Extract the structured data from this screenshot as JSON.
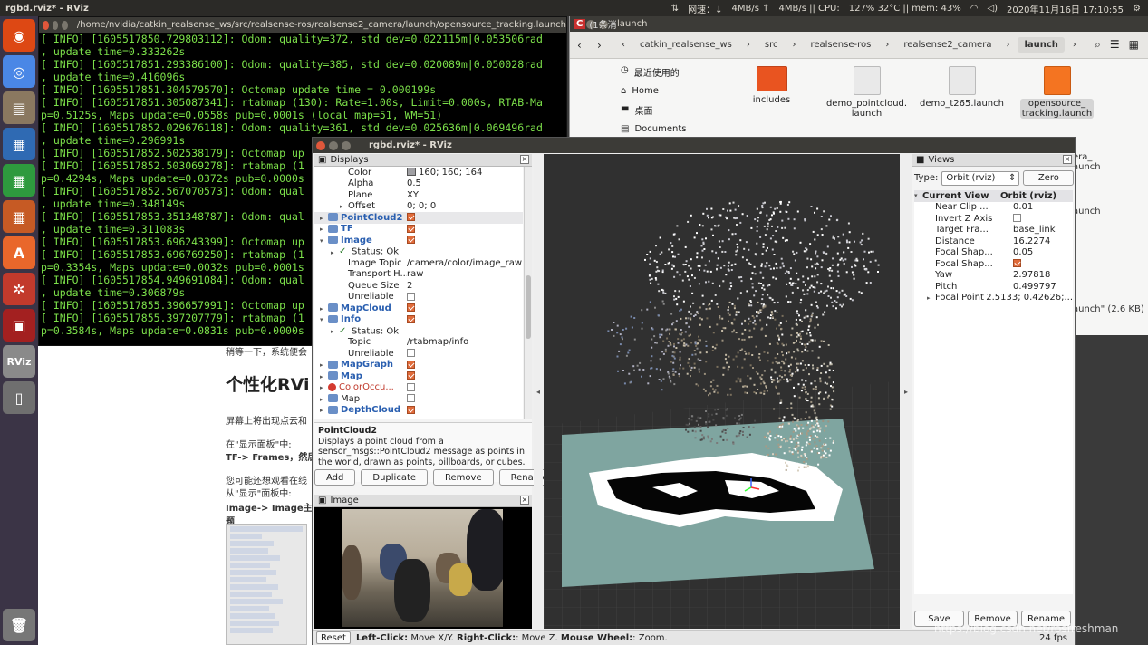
{
  "topbar": {
    "window_title": "rgbd.rviz* - RViz",
    "net_label": "网速：↓",
    "net_down": "4MB/s ↑",
    "net_up": "4MB/s || CPU:",
    "cpu": "127% 32°C || mem: 43%",
    "datetime": "2020年11月16日 17:10:55"
  },
  "launcher": {
    "items": [
      {
        "name": "ubuntu-dash-icon",
        "color": "#dd4814",
        "glyph": "◉"
      },
      {
        "name": "chrome-icon",
        "color": "#4a87e6",
        "glyph": "◎"
      },
      {
        "name": "files-icon",
        "color": "#8a7860",
        "glyph": "▤"
      },
      {
        "name": "writer-icon",
        "color": "#2f6ab3",
        "glyph": "▦"
      },
      {
        "name": "calc-icon",
        "color": "#2e9a3e",
        "glyph": "▦"
      },
      {
        "name": "impress-icon",
        "color": "#c65a24",
        "glyph": "▦"
      },
      {
        "name": "software-center-icon",
        "color": "#e9672b",
        "glyph": "A"
      },
      {
        "name": "settings-icon",
        "color": "#c23a2c",
        "glyph": "✲"
      },
      {
        "name": "terminal-icon",
        "color": "#a32020",
        "glyph": "▣"
      },
      {
        "name": "rviz-icon",
        "color": "#8a8a8a",
        "glyph": "RViz"
      },
      {
        "name": "usb-drive-icon",
        "color": "#6f6f6f",
        "glyph": "▯"
      }
    ],
    "trash": {
      "name": "trash-icon",
      "color": "#777",
      "glyph": "🗑"
    }
  },
  "terminal": {
    "title": "/home/nvidia/catkin_realsense_ws/src/realsense-ros/realsense2_camera/launch/opensource_tracking.launch",
    "lines": [
      "[ INFO] [1605517850.729803112]: Odom: quality=372, std dev=0.022115m|0.053506rad",
      ", update time=0.333262s",
      "[ INFO] [1605517851.293386100]: Odom: quality=385, std dev=0.020089m|0.050028rad",
      ", update time=0.416096s",
      "[ INFO] [1605517851.304579570]: Octomap update time = 0.000199s",
      "[ INFO] [1605517851.305087341]: rtabmap (130): Rate=1.00s, Limit=0.000s, RTAB-Ma",
      "p=0.5125s, Maps update=0.0558s pub=0.0001s (local map=51, WM=51)",
      "[ INFO] [1605517852.029676118]: Odom: quality=361, std dev=0.025636m|0.069496rad",
      ", update time=0.296991s",
      "[ INFO] [1605517852.502538179]: Octomap up",
      "[ INFO] [1605517852.503069278]: rtabmap (1",
      "p=0.4294s, Maps update=0.0372s pub=0.0000s",
      "[ INFO] [1605517852.567070573]: Odom: qual",
      ", update time=0.348149s",
      "[ INFO] [1605517853.351348787]: Odom: qual",
      ", update time=0.311083s",
      "[ INFO] [1605517853.696243399]: Octomap up",
      "[ INFO] [1605517853.696769250]: rtabmap (1",
      "p=0.3354s, Maps update=0.0032s pub=0.0001s",
      "[ INFO] [1605517854.949691084]: Odom: qual",
      ", update time=0.306879s",
      "[ INFO] [1605517855.396657991]: Octomap up",
      "[ INFO] [1605517855.397207779]: rtabmap (1",
      "p=0.3584s, Maps update=0.0831s pub=0.0000s"
    ]
  },
  "files": {
    "title": "launch",
    "tab_peek": "(1条消",
    "breadcrumbs": [
      "catkin_realsense_ws",
      "src",
      "realsense-ros",
      "realsense2_camera",
      "launch"
    ],
    "sidebar": [
      {
        "icon": "clock-icon",
        "glyph": "◷",
        "label": "最近使用的"
      },
      {
        "icon": "home-icon",
        "glyph": "⌂",
        "label": "Home"
      },
      {
        "icon": "desktop-icon",
        "glyph": "▬",
        "label": "桌面"
      },
      {
        "icon": "documents-icon",
        "glyph": "▤",
        "label": "Documents"
      }
    ],
    "items": [
      {
        "label": "includes",
        "kind": "folder"
      },
      {
        "label": "demo_pointcloud.\nlaunch",
        "kind": "file"
      },
      {
        "label": "demo_t265.launch",
        "kind": "file"
      },
      {
        "label": "opensource_\ntracking.launch",
        "kind": "orange"
      }
    ],
    "peek_1": "era_",
    "peek_2": "aunch",
    "peek_3": "aunch",
    "peek_status": "aunch\" (2.6 KB)"
  },
  "webpage": {
    "line1": "稍等一下，系统便会",
    "heading": "个性化RVi",
    "line2": "屏幕上将出现点云和",
    "line3": "在\"显示面板\"中:",
    "line4": "TF-> Frames，然后",
    "line5": "您可能还想观看在线",
    "line6": "从\"显示\"面板中:",
    "line7": "Image-> Image主题"
  },
  "rviz": {
    "title": "rgbd.rviz* - RViz",
    "displays": {
      "header": "Displays",
      "rows": [
        {
          "key": "Color",
          "value": "160; 160; 164",
          "indent": 2,
          "swatch": true
        },
        {
          "key": "Alpha",
          "value": "0.5",
          "indent": 2
        },
        {
          "key": "Plane",
          "value": "XY",
          "indent": 2
        },
        {
          "key": "Offset",
          "value": "0; 0; 0",
          "indent": 2,
          "arrow": "▸"
        },
        {
          "key": "PointCloud2",
          "value": "",
          "indent": 0,
          "arrow": "▸",
          "check": true,
          "blue": true,
          "icon": "pointcloud-icon",
          "selected": true
        },
        {
          "key": "TF",
          "value": "",
          "indent": 0,
          "arrow": "▸",
          "check": true,
          "blue": true,
          "icon": "tf-icon"
        },
        {
          "key": "Image",
          "value": "",
          "indent": 0,
          "arrow": "▾",
          "check": true,
          "blue": true,
          "icon": "image-icon"
        },
        {
          "key": "Status: Ok",
          "value": "",
          "indent": 1,
          "arrow": "▸",
          "status": true
        },
        {
          "key": "Image Topic",
          "value": "/camera/color/image_raw",
          "indent": 2
        },
        {
          "key": "Transport H...",
          "value": "raw",
          "indent": 2
        },
        {
          "key": "Queue Size",
          "value": "2",
          "indent": 2
        },
        {
          "key": "Unreliable",
          "value": "",
          "indent": 2,
          "check": false
        },
        {
          "key": "MapCloud",
          "value": "",
          "indent": 0,
          "arrow": "▸",
          "check": true,
          "blue": true,
          "icon": "mapcloud-icon"
        },
        {
          "key": "Info",
          "value": "",
          "indent": 0,
          "arrow": "▾",
          "check": true,
          "blue": true,
          "icon": "info-icon"
        },
        {
          "key": "Status: Ok",
          "value": "",
          "indent": 1,
          "arrow": "▸",
          "status": true
        },
        {
          "key": "Topic",
          "value": "/rtabmap/info",
          "indent": 2
        },
        {
          "key": "Unreliable",
          "value": "",
          "indent": 2,
          "check": false
        },
        {
          "key": "MapGraph",
          "value": "",
          "indent": 0,
          "arrow": "▸",
          "check": true,
          "blue": true,
          "icon": "mapgraph-icon"
        },
        {
          "key": "Map",
          "value": "",
          "indent": 0,
          "arrow": "▸",
          "check": true,
          "blue": true,
          "icon": "map-icon"
        },
        {
          "key": "ColorOccu...",
          "value": "",
          "indent": 0,
          "arrow": "▸",
          "check": false,
          "red": true,
          "icon": "error-icon"
        },
        {
          "key": "Map",
          "value": "",
          "indent": 0,
          "arrow": "▸",
          "check": false,
          "icon": "map-icon"
        },
        {
          "key": "DepthCloud",
          "value": "",
          "indent": 0,
          "arrow": "▸",
          "check": true,
          "blue": true,
          "icon": "depthcloud-icon"
        }
      ],
      "desc_title": "PointCloud2",
      "desc_body": "Displays a point cloud from a sensor_msgs::PointCloud2 message as points in the world, drawn as points, billboards, or cubes.",
      "buttons": [
        "Add",
        "Duplicate",
        "Remove",
        "Rename"
      ]
    },
    "image_panel_header": "Image",
    "views": {
      "header": "Views",
      "type_label": "Type:",
      "type_value": "Orbit (rviz)",
      "zero_label": "Zero",
      "head_key": "Current View",
      "head_value": "Orbit (rviz)",
      "rows": [
        {
          "key": "Near Clip ...",
          "value": "0.01"
        },
        {
          "key": "Invert Z Axis",
          "value": "",
          "check": false
        },
        {
          "key": "Target Fra...",
          "value": "base_link"
        },
        {
          "key": "Distance",
          "value": "16.2274"
        },
        {
          "key": "Focal Shap...",
          "value": "0.05"
        },
        {
          "key": "Focal Shap...",
          "value": "",
          "check": true
        },
        {
          "key": "Yaw",
          "value": "2.97818"
        },
        {
          "key": "Pitch",
          "value": "0.499797"
        },
        {
          "key": "Focal Point",
          "value": "2.5133; 0.42626;...",
          "arrow": "▸"
        }
      ],
      "buttons": [
        "Save",
        "Remove",
        "Rename"
      ]
    },
    "status": {
      "reset": "Reset",
      "left_click": "Left-Click:",
      "left_desc": " Move X/Y. ",
      "right_click": "Right-Click:",
      "right_desc": ": Move Z. ",
      "wheel": "Mouse Wheel:",
      "wheel_desc": ": Zoom.",
      "fps": "24 fps"
    }
  },
  "watermark": "https://blog.csdn.net/rosfreshman",
  "colors": {
    "terminal_text": "#7ce04a",
    "ubuntu_orange": "#e95420",
    "rviz_ground": "#7fa5a0",
    "viewport_bg": "#303030"
  }
}
